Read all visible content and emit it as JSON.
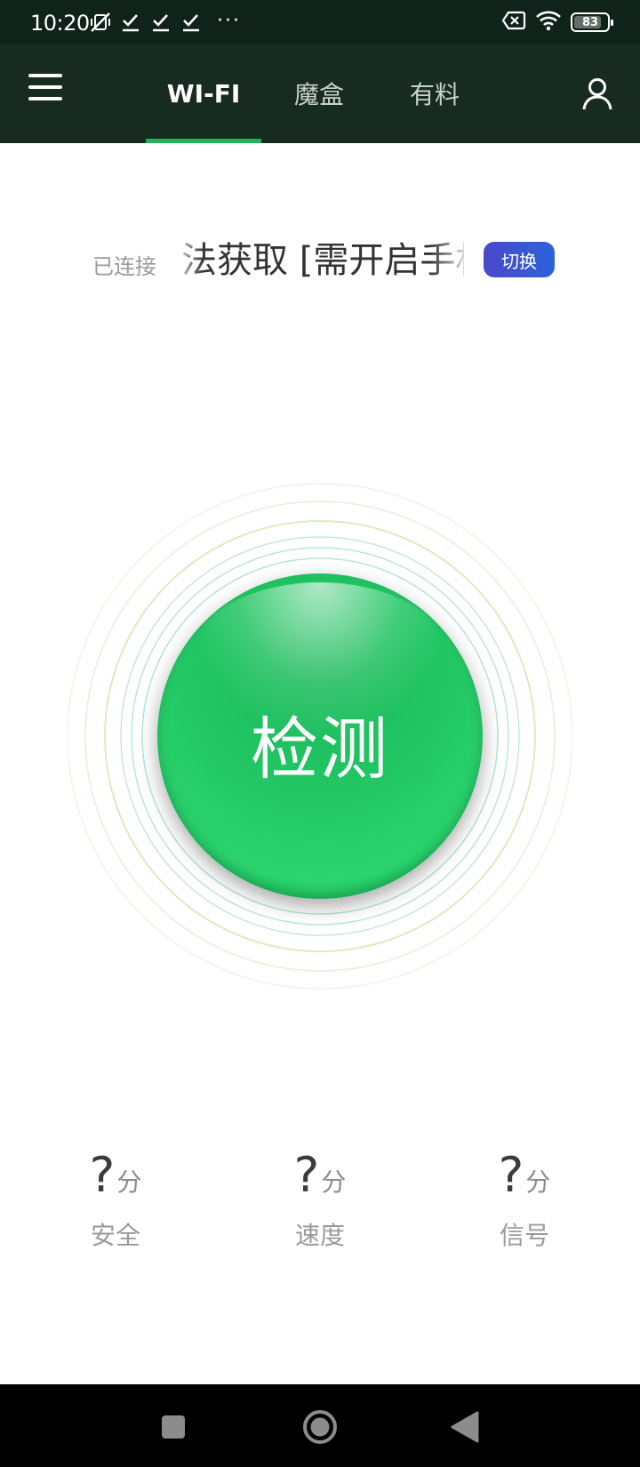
{
  "status_bar": {
    "time": "10:20",
    "battery": "83",
    "battery_level": 0.83,
    "more_indicator": "···",
    "icons_left": [
      "mute-vibrate-icon",
      "check-icon",
      "check-icon",
      "check-icon"
    ],
    "icons_right": [
      "sim-off-icon",
      "wifi-icon",
      "battery-icon"
    ]
  },
  "header": {
    "tabs": [
      {
        "label": "WI-FI",
        "active": true
      },
      {
        "label": "魔盒",
        "active": false
      },
      {
        "label": "有料",
        "active": false
      }
    ],
    "menu_icon": "hamburger-menu-icon",
    "user_icon": "user-profile-icon",
    "accent_color": "#21b25a",
    "background_color": "#182b21"
  },
  "connection": {
    "label": "已连接",
    "ssid": "法获取 [需开启手机",
    "switch_label": "切换",
    "switch_color": "#3b55d0"
  },
  "detect": {
    "label": "检测",
    "color": "#22c764"
  },
  "scores": [
    {
      "value": "?",
      "unit": "分",
      "label": "安全"
    },
    {
      "value": "?",
      "unit": "分",
      "label": "速度"
    },
    {
      "value": "?",
      "unit": "分",
      "label": "信号"
    }
  ],
  "nav": {
    "icons": [
      "recent-apps-icon",
      "home-icon",
      "back-icon"
    ]
  }
}
